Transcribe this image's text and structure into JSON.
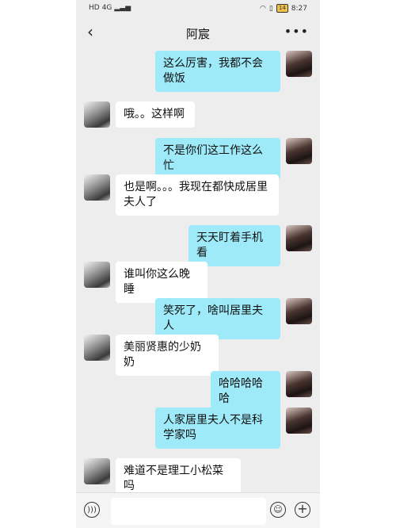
{
  "status": {
    "carrier": "HD",
    "signal": "4G",
    "battery": "14",
    "time": "8:27"
  },
  "header": {
    "back_icon": "chevron-left-icon",
    "title": "阿宸",
    "more_icon": "more-dots-icon"
  },
  "messages": [
    {
      "side": "mine",
      "text": "这么厉害，我都不会做饭"
    },
    {
      "side": "theirs",
      "text": "哦。。这样啊"
    },
    {
      "side": "mine",
      "text": "不是你们这工作这么忙"
    },
    {
      "side": "theirs",
      "text": "也是啊。。。我现在都快成居里夫人了"
    },
    {
      "side": "mine",
      "text": "天天盯着手机看"
    },
    {
      "side": "theirs",
      "text": "谁叫你这么晚睡"
    },
    {
      "side": "mine",
      "text": "笑死了，啥叫居里夫人"
    },
    {
      "side": "theirs",
      "text": "美丽贤惠的少奶奶"
    },
    {
      "side": "mine",
      "text": "哈哈哈哈哈"
    },
    {
      "side": "mine",
      "text": "人家居里夫人不是科学家吗"
    },
    {
      "side": "theirs",
      "text": "难道不是理工小松菜吗"
    }
  ],
  "input_bar": {
    "voice_icon": "voice-icon",
    "emoji_icon": "emoji-icon",
    "plus_icon": "plus-icon",
    "placeholder": ""
  }
}
